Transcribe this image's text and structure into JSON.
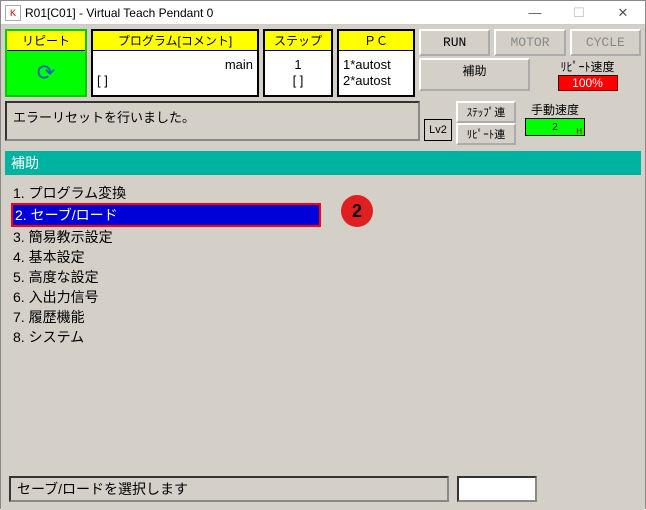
{
  "window": {
    "title": "R01[C01] - Virtual Teach Pendant 0"
  },
  "top": {
    "repeat_label": "リピート",
    "program_label": "プログラム[コメント]",
    "program_value": "main",
    "program_bracket": "[             ]",
    "step_label": "ステップ",
    "step_value": "1",
    "step_bracket": "[   ]",
    "pc_label": "ＰＣ",
    "pc_row1": "1*autost",
    "pc_row2": "2*autost"
  },
  "buttons": {
    "run": "RUN",
    "motor": "MOTOR",
    "cycle": "CYCLE",
    "aux": "補助"
  },
  "speed": {
    "repeat_label": "ﾘﾋﾟｰﾄ速度",
    "repeat_value": "100%",
    "manual_label": "手動速度",
    "manual_value": "2"
  },
  "message": "エラーリセットを行いました。",
  "lv2": "Lv2",
  "step_cont": "ｽﾃｯﾌﾟ連",
  "repeat_cont": "ﾘﾋﾟｰﾄ連",
  "section_header": "補助",
  "menu": {
    "items": [
      {
        "num": "1.",
        "label": "プログラム変換"
      },
      {
        "num": "2.",
        "label": "セーブ/ロード"
      },
      {
        "num": "3.",
        "label": "簡易教示設定"
      },
      {
        "num": "4.",
        "label": "基本設定"
      },
      {
        "num": "5.",
        "label": "高度な設定"
      },
      {
        "num": "6.",
        "label": "入出力信号"
      },
      {
        "num": "7.",
        "label": "履歴機能"
      },
      {
        "num": "8.",
        "label": "システム"
      }
    ],
    "selected_index": 1
  },
  "annotation": "2",
  "status": "セーブ/ロードを選択します"
}
